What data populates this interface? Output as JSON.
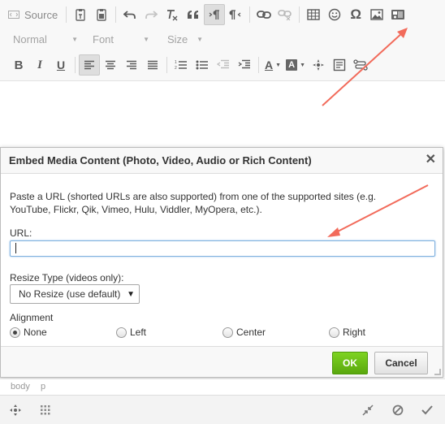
{
  "toolbar": {
    "source_label": "Source",
    "format_combo": "Normal",
    "font_combo": "Font",
    "size_combo": "Size",
    "font_color_label": "A",
    "bg_color_label": "A"
  },
  "dialog": {
    "title": "Embed Media Content (Photo, Video, Audio or Rich Content)",
    "close_label": "✕",
    "description": "Paste a URL (shorted URLs are also supported) from one of the supported sites (e.g. YouTube, Flickr, Qik, Vimeo, Hulu, Viddler, MyOpera, etc.).",
    "url_label": "URL:",
    "url_value": "",
    "resize_label": "Resize Type (videos only):",
    "resize_selected": "No Resize (use default)",
    "alignment_label": "Alignment",
    "alignment_options": [
      "None",
      "Left",
      "Center",
      "Right"
    ],
    "alignment_selected": "None",
    "ok_label": "OK",
    "cancel_label": "Cancel"
  },
  "path_bar": {
    "items": [
      "body",
      "p"
    ]
  },
  "colors": {
    "accent_green": "#6cc117",
    "arrow_red": "#f26b5b",
    "input_focus": "#7fb1df"
  }
}
